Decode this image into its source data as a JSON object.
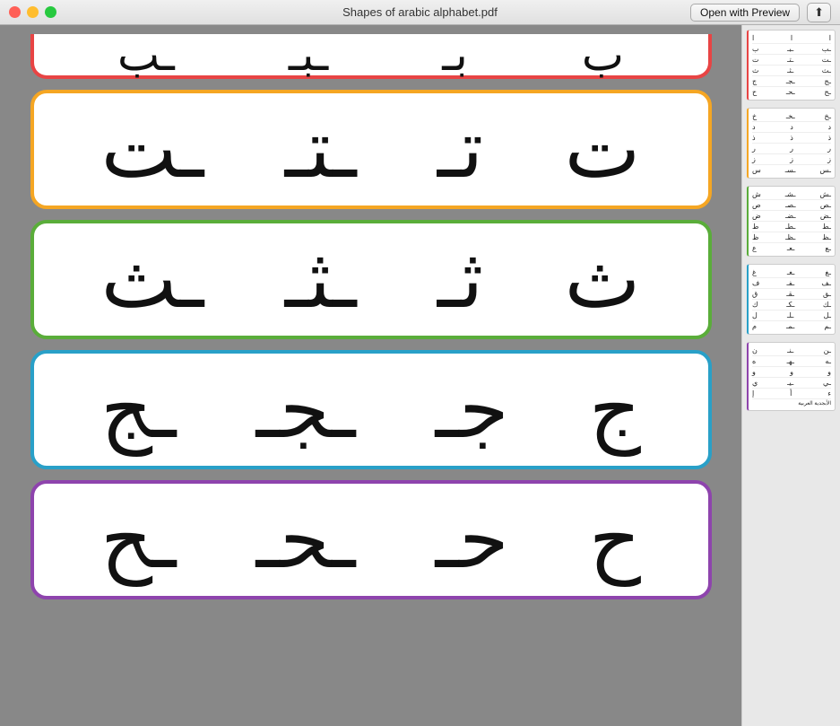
{
  "titlebar": {
    "title": "Shapes of arabic alphabet.pdf",
    "open_preview_label": "Open with Preview",
    "share_label": "⬆"
  },
  "cards": [
    {
      "id": "card-top-partial",
      "color": "red",
      "chars": [
        "ب",
        "ب",
        "ب",
        "ب"
      ],
      "partial": true
    },
    {
      "id": "card-ta",
      "color": "orange",
      "chars": [
        "ت",
        "تـ",
        "ـتـ",
        "ـت"
      ]
    },
    {
      "id": "card-tha",
      "color": "green",
      "chars": [
        "ث",
        "ثـ",
        "ـثـ",
        "ـث"
      ]
    },
    {
      "id": "card-jim",
      "color": "blue",
      "chars": [
        "ج",
        "جـ",
        "ـجـ",
        "ـج"
      ]
    },
    {
      "id": "card-ha",
      "color": "purple",
      "chars": [
        "ح",
        "حـ",
        "ـحـ",
        "ـح"
      ]
    }
  ],
  "sidebar": {
    "groups": [
      {
        "color": "red",
        "rows": [
          {
            "chars": [
              "ا",
              "ا",
              "ا"
            ]
          },
          {
            "chars": [
              "ب",
              "بـ",
              "ـب"
            ]
          },
          {
            "chars": [
              "ت",
              "تـ",
              "ـت"
            ]
          },
          {
            "chars": [
              "ث",
              "ثـ",
              "ـث"
            ]
          },
          {
            "chars": [
              "ج",
              "جـ",
              "ـج"
            ]
          },
          {
            "chars": [
              "ح",
              "حـ",
              "ـح"
            ]
          }
        ]
      },
      {
        "color": "orange",
        "rows": [
          {
            "chars": [
              "خ",
              "خـ",
              "ـخ"
            ]
          },
          {
            "chars": [
              "د",
              "د",
              "د"
            ]
          },
          {
            "chars": [
              "ذ",
              "ذ",
              "ذ"
            ]
          },
          {
            "chars": [
              "ر",
              "ر",
              "ر"
            ]
          },
          {
            "chars": [
              "ز",
              "ز",
              "ز"
            ]
          },
          {
            "chars": [
              "س",
              "سـ",
              "ـس"
            ]
          }
        ]
      },
      {
        "color": "green",
        "rows": [
          {
            "chars": [
              "ش",
              "شـ",
              "ـش"
            ]
          },
          {
            "chars": [
              "ص",
              "صـ",
              "ـص"
            ]
          },
          {
            "chars": [
              "ض",
              "ضـ",
              "ـض"
            ]
          },
          {
            "chars": [
              "ط",
              "طـ",
              "ـط"
            ]
          },
          {
            "chars": [
              "ظ",
              "ظـ",
              "ـظ"
            ]
          },
          {
            "chars": [
              "ع",
              "عـ",
              "ـع"
            ]
          }
        ]
      },
      {
        "color": "blue",
        "rows": [
          {
            "chars": [
              "غ",
              "غـ",
              "ـغ"
            ]
          },
          {
            "chars": [
              "ف",
              "فـ",
              "ـف"
            ]
          },
          {
            "chars": [
              "ق",
              "قـ",
              "ـق"
            ]
          },
          {
            "chars": [
              "ك",
              "كـ",
              "ـك"
            ]
          },
          {
            "chars": [
              "ل",
              "لـ",
              "ـل"
            ]
          },
          {
            "chars": [
              "م",
              "مـ",
              "ـم"
            ]
          }
        ]
      },
      {
        "color": "purple",
        "rows": [
          {
            "chars": [
              "ن",
              "نـ",
              "ـن"
            ]
          },
          {
            "chars": [
              "ه",
              "هـ",
              "ـه"
            ]
          },
          {
            "chars": [
              "و",
              "و",
              "و"
            ]
          },
          {
            "chars": [
              "ي",
              "يـ",
              "ـي"
            ]
          },
          {
            "chars": [
              "ء",
              "أ",
              "إ"
            ]
          },
          {
            "chars": [
              "الأبجدية العربية"
            ]
          }
        ]
      }
    ]
  }
}
